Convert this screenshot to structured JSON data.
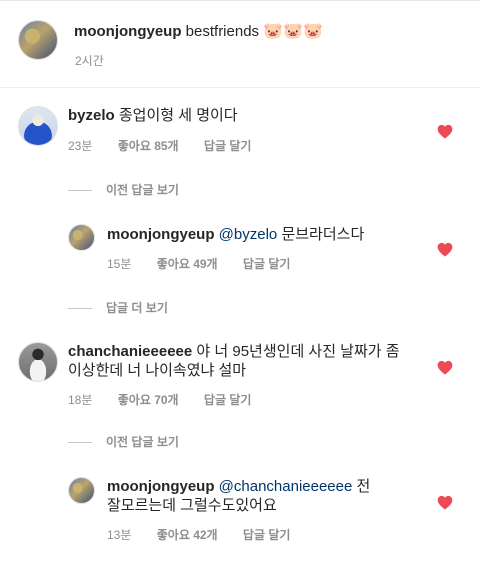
{
  "caption": {
    "username": "moonjongyeup",
    "text": "bestfriends",
    "emoji": [
      "🐷",
      "🐷",
      "🐷"
    ],
    "time": "2시간"
  },
  "comments": [
    {
      "username": "byzelo",
      "text": "종업이형 세 명이다",
      "time": "23분",
      "likes": "좋아요 85개",
      "reply_label": "답글 달기",
      "liked": true
    },
    {
      "view_replies_label": "이전 답글 보기"
    },
    {
      "username": "moonjongyeup",
      "mention": "@byzelo",
      "text": "문브라더스다",
      "time": "15분",
      "likes": "좋아요 49개",
      "reply_label": "답글 달기",
      "liked": true
    },
    {
      "view_replies_label": "답글 더 보기"
    },
    {
      "username": "chanchanieeeeee",
      "text_line1": "야 너 95년생인데 사진 날짜가 좀",
      "text_line2": "이상한데 너 나이속였냐 설마",
      "time": "18분",
      "likes": "좋아요 70개",
      "reply_label": "답글 달기",
      "liked": true
    },
    {
      "view_replies_label": "이전 답글 보기"
    },
    {
      "username": "moonjongyeup",
      "mention": "@chanchanieeeeee",
      "text_line1_tail": "전",
      "text_line2": "잘모르는데 그럴수도있어요",
      "time": "13분",
      "likes": "좋아요 42개",
      "reply_label": "답글 달기",
      "liked": true
    }
  ],
  "colors": {
    "heart": "#ed4956",
    "meta": "#8e8e8e",
    "mention": "#003569"
  }
}
